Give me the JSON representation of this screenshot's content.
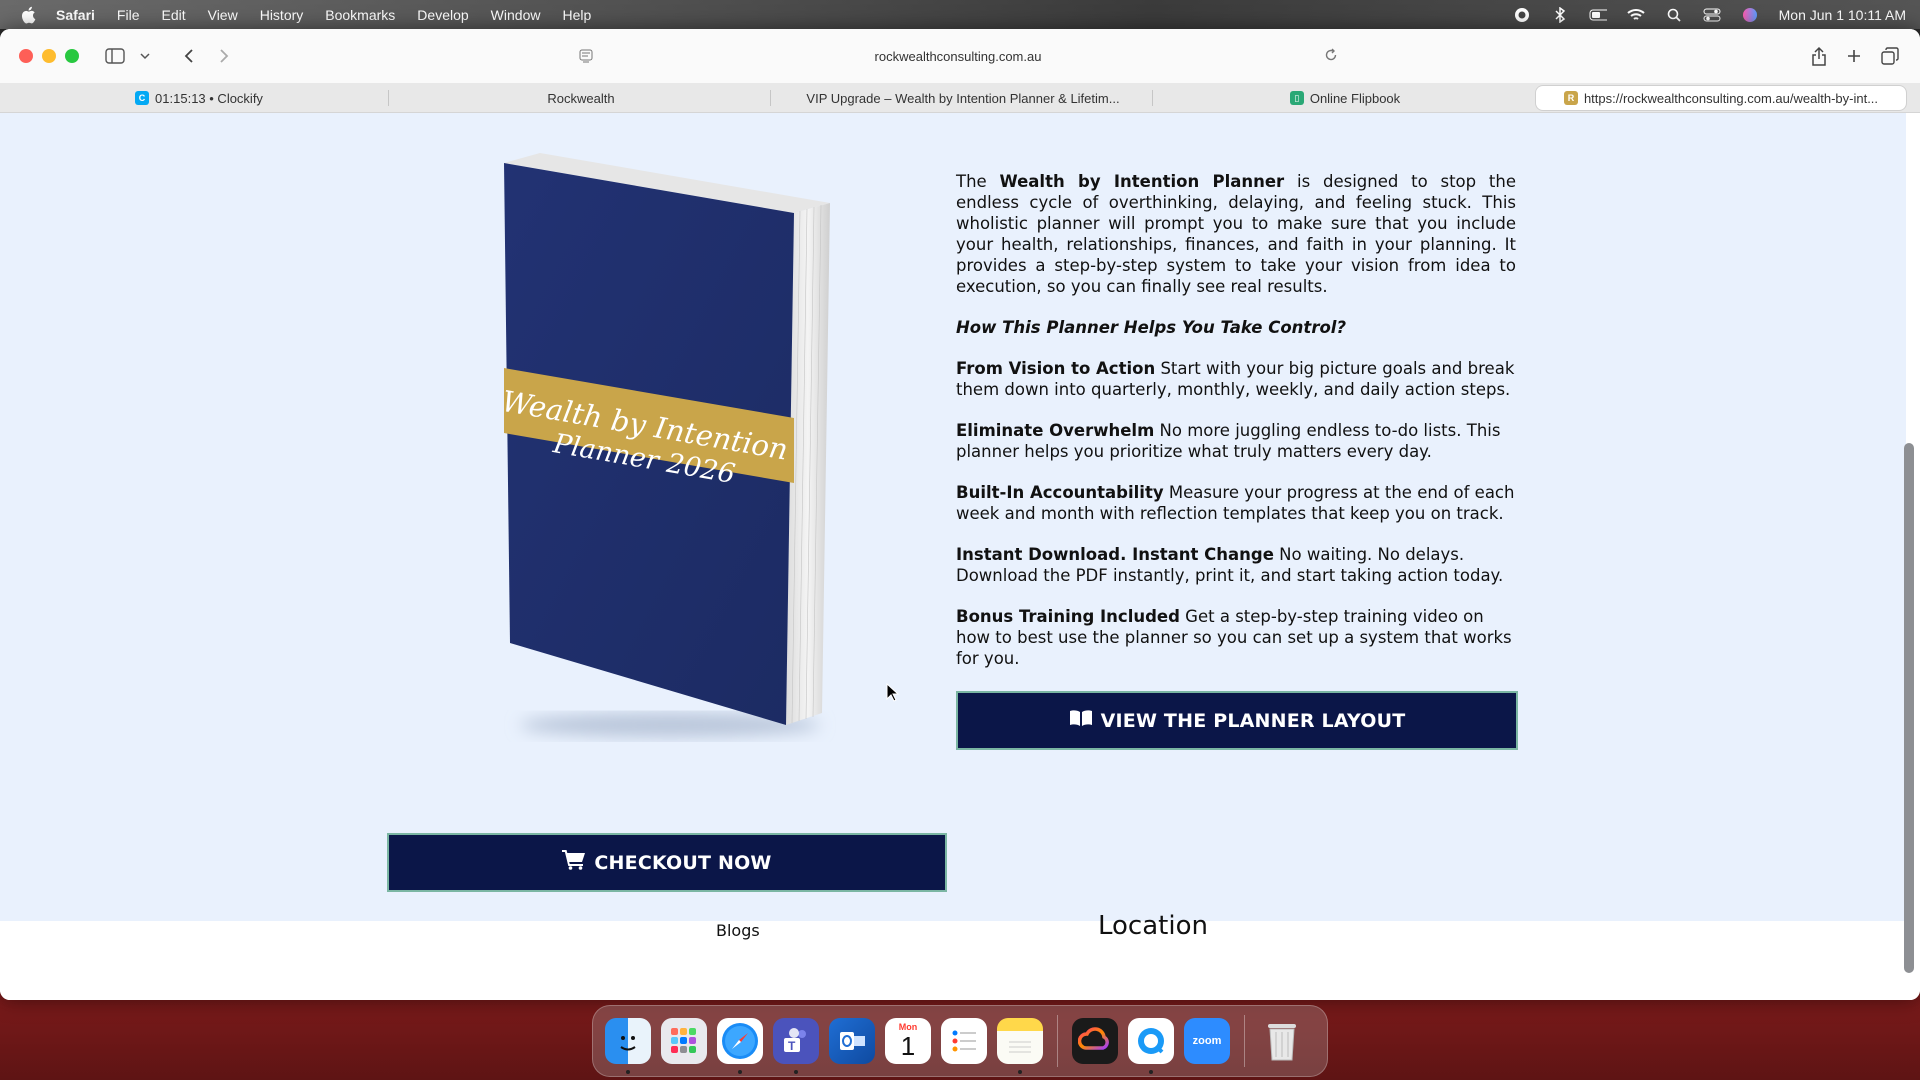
{
  "menubar": {
    "app": "Safari",
    "items": [
      "File",
      "Edit",
      "View",
      "History",
      "Bookmarks",
      "Develop",
      "Window",
      "Help"
    ],
    "clock": "Mon Jun 1  10:11 AM"
  },
  "browser": {
    "url": "rockwealthconsulting.com.au",
    "tabs": [
      {
        "label": "01:15:13 • Clockify",
        "icon": "clockify-icon"
      },
      {
        "label": "Rockwealth",
        "icon": ""
      },
      {
        "label": "VIP Upgrade – Wealth by Intention Planner & Lifetim...",
        "icon": ""
      },
      {
        "label": "Online Flipbook",
        "icon": "flipbook-icon"
      },
      {
        "label": "https://rockwealthconsulting.com.au/wealth-by-int...",
        "icon": "rockwealth-icon"
      }
    ]
  },
  "page": {
    "book": {
      "title_line1": "Wealth by Intention",
      "title_line2": "Planner 2026"
    },
    "intro_pre": "The ",
    "intro_bold": "Wealth by Intention Planner",
    "intro_post": " is designed to stop the endless cycle of overthinking, delaying, and feeling stuck. This wholistic planner will prompt you to make sure that you include your health, relationships, finances, and faith in your planning. It provides a step-by-step system to take your vision from idea to execution, so you can finally see real results.",
    "subhead": "How This Planner Helps You Take Control?",
    "features": [
      {
        "title": "From Vision to Action",
        "text": " Start with your big picture goals and break them down into quarterly, monthly, weekly, and daily action steps."
      },
      {
        "title": "Eliminate Overwhelm",
        "text": " No more juggling endless to-do lists. This planner helps you prioritize what truly matters every day."
      },
      {
        "title": "Built-In Accountability",
        "text": " Measure your progress at the end of each week and month with reflection templates that keep you on track."
      },
      {
        "title": "Instant Download. Instant Change",
        "text": " No waiting. No delays. Download the PDF instantly, print it, and start taking action today."
      },
      {
        "title": "Bonus Training Included",
        "text": " Get a step-by-step training video on how to best use the planner so you can set up a system that works for you."
      }
    ],
    "planner_button": "VIEW THE PLANNER LAYOUT",
    "checkout_button": "CHECKOUT NOW",
    "footer": {
      "blogs": "Blogs",
      "location": "Location"
    }
  },
  "dock": {
    "apps": [
      "finder-icon",
      "launchpad-icon",
      "safari-icon",
      "teams-icon",
      "outlook-icon",
      "calendar-icon",
      "reminders-icon",
      "notes-icon",
      "creative-cloud-icon",
      "quickshare-icon",
      "zoom-icon",
      "trash-icon"
    ],
    "calendar_month": "Mon",
    "calendar_day": "1",
    "zoom_label": "zoom"
  },
  "colors": {
    "navy": "#0b1648",
    "section_bg": "#e9f1fd",
    "book_cover": "#1f2f6b",
    "book_band": "#c9a54a"
  }
}
